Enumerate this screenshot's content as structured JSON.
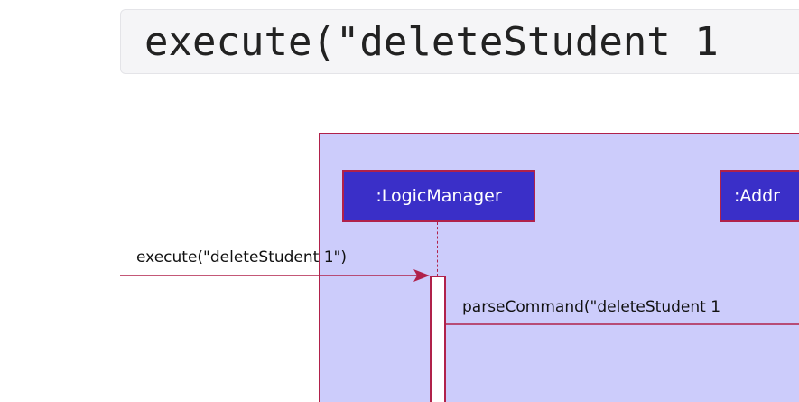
{
  "header": {
    "code_text": "execute(\"deleteStudent 1"
  },
  "diagram": {
    "participants": [
      {
        "label": ":LogicManager"
      },
      {
        "label": ":Addr"
      }
    ],
    "messages": [
      {
        "label": "execute(\"deleteStudent 1\")"
      },
      {
        "label": "parseCommand(\"deleteStudent 1"
      }
    ],
    "colors": {
      "frame_fill": "#ccccfb",
      "border": "#b0214a",
      "participant_fill": "#3a2fc8",
      "participant_text": "#ffffff",
      "activation_fill": "#ffffff"
    }
  }
}
